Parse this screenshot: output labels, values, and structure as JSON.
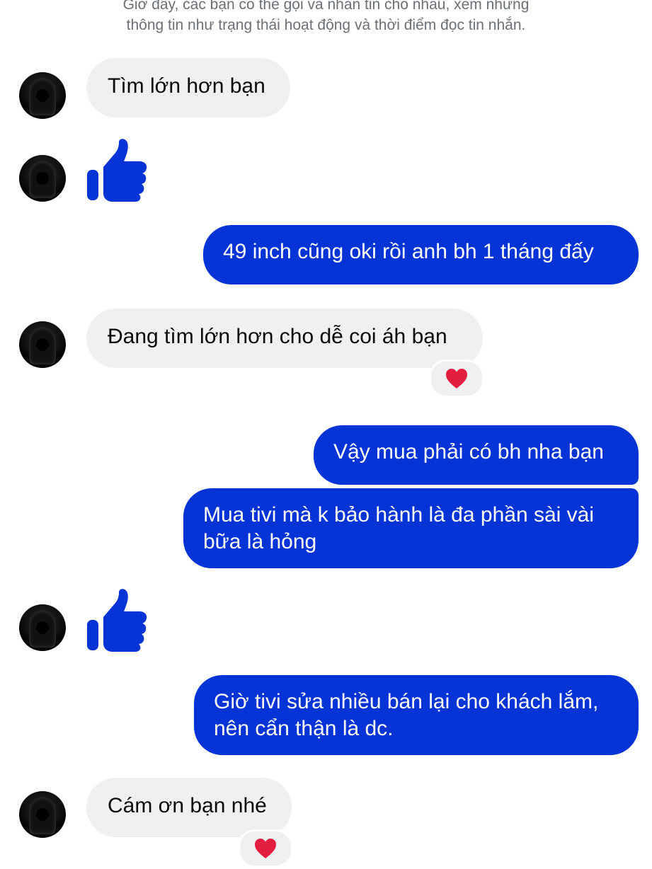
{
  "notice": {
    "line1": "Giờ đây, các bạn có thể gọi và nhắn tin cho nhau, xem những",
    "line2": "thông tin như trạng thái hoạt động và thời điểm đọc tin nhắn."
  },
  "messages": [
    {
      "from": "them",
      "text": "Tìm lớn hơn bạn"
    },
    {
      "from": "them",
      "type": "like",
      "icon": "thumbs-up-icon"
    },
    {
      "from": "me",
      "text": "49 inch cũng oki rồi anh bh 1 tháng đấy"
    },
    {
      "from": "them",
      "text": "Đang tìm lớn hơn cho dễ coi áh bạn",
      "reaction": "heart-icon"
    },
    {
      "from": "me",
      "text": "Vậy mua phải có bh nha bạn"
    },
    {
      "from": "me",
      "text": "Mua tivi mà k bảo hành là đa phần sài vài bữa là hỏng"
    },
    {
      "from": "them",
      "type": "like",
      "icon": "thumbs-up-icon"
    },
    {
      "from": "me",
      "text": "Giờ tivi sửa nhiều bán lại cho khách lắm, nên cẩn thận là dc."
    },
    {
      "from": "them",
      "text": "Cám ơn bạn nhé",
      "reaction": "heart-icon"
    }
  ],
  "colors": {
    "outgoing_bubble": "#0433d6",
    "incoming_bubble": "#f0f0f2",
    "like_icon": "#0433d6",
    "heart": "#e41e3f"
  }
}
